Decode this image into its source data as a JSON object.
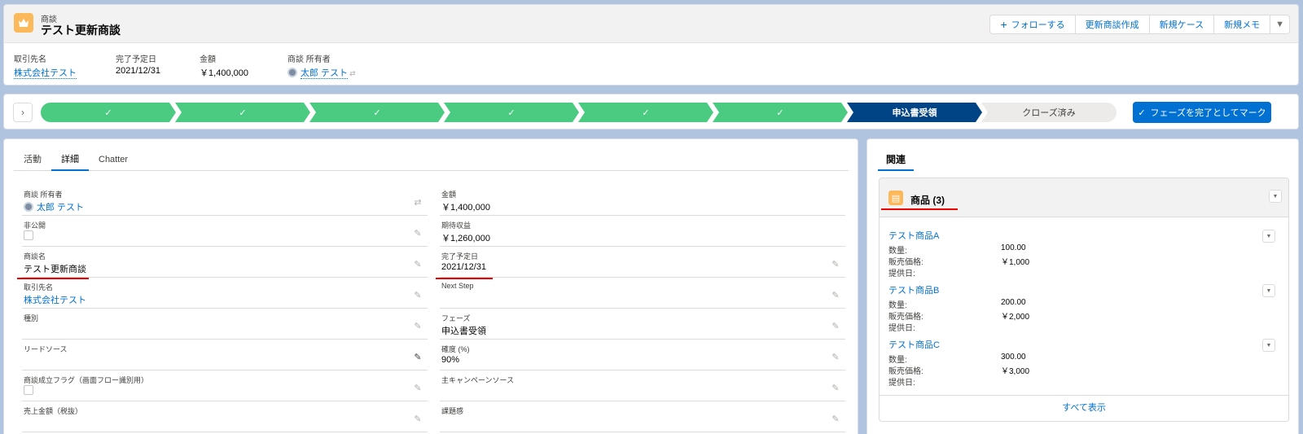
{
  "header": {
    "object_type": "商談",
    "record_title": "テスト更新商談",
    "buttons": {
      "follow": "フォローする",
      "create_renewal": "更新商談作成",
      "new_case": "新規ケース",
      "new_memo": "新規メモ"
    },
    "fields": [
      {
        "label": "取引先名",
        "value": "株式会社テスト"
      },
      {
        "label": "完了予定日",
        "value": "2021/12/31"
      },
      {
        "label": "金額",
        "value": "￥1,400,000"
      },
      {
        "label": "商談 所有者",
        "value": "太郎 テスト"
      }
    ]
  },
  "path": {
    "steps": [
      {
        "label": "✓",
        "state": "done"
      },
      {
        "label": "✓",
        "state": "done"
      },
      {
        "label": "✓",
        "state": "done"
      },
      {
        "label": "✓",
        "state": "done"
      },
      {
        "label": "✓",
        "state": "done"
      },
      {
        "label": "✓",
        "state": "done"
      },
      {
        "label": "申込書受領",
        "state": "current"
      },
      {
        "label": "クローズ済み",
        "state": "todo"
      }
    ],
    "mark_button": "フェーズを完了としてマーク"
  },
  "tabs": [
    "活動",
    "詳細",
    "Chatter"
  ],
  "details": {
    "left": [
      {
        "label": "商談 所有者",
        "value": "太郎 テスト"
      },
      {
        "label": "非公開",
        "value": ""
      },
      {
        "label": "商談名",
        "value": "テスト更新商談"
      },
      {
        "label": "取引先名",
        "value": "株式会社テスト"
      },
      {
        "label": "種別",
        "value": ""
      },
      {
        "label": "リードソース",
        "value": ""
      },
      {
        "label": "商談成立フラグ（画面フロー識別用）",
        "value": ""
      },
      {
        "label": "売上金額（税抜）",
        "value": ""
      }
    ],
    "right": [
      {
        "label": "金額",
        "value": "￥1,400,000"
      },
      {
        "label": "期待収益",
        "value": "￥1,260,000"
      },
      {
        "label": "完了予定日",
        "value": "2021/12/31"
      },
      {
        "label": "Next Step",
        "value": ""
      },
      {
        "label": "フェーズ",
        "value": "申込書受領"
      },
      {
        "label": "確度 (%)",
        "value": "90%"
      },
      {
        "label": "主キャンペーンソース",
        "value": ""
      },
      {
        "label": "課題感",
        "value": ""
      }
    ]
  },
  "related": {
    "tab": "関連",
    "list_title": "商品 (3)",
    "items": [
      {
        "name": "テスト商品A",
        "qty_label": "数量:",
        "qty": "100.00",
        "price_label": "販売価格:",
        "price": "￥1,000",
        "date_label": "提供日:",
        "date": ""
      },
      {
        "name": "テスト商品B",
        "qty_label": "数量:",
        "qty": "200.00",
        "price_label": "販売価格:",
        "price": "￥2,000",
        "date_label": "提供日:",
        "date": ""
      },
      {
        "name": "テスト商品C",
        "qty_label": "数量:",
        "qty": "300.00",
        "price_label": "販売価格:",
        "price": "￥3,000",
        "date_label": "提供日:",
        "date": ""
      }
    ],
    "view_all": "すべて表示"
  }
}
